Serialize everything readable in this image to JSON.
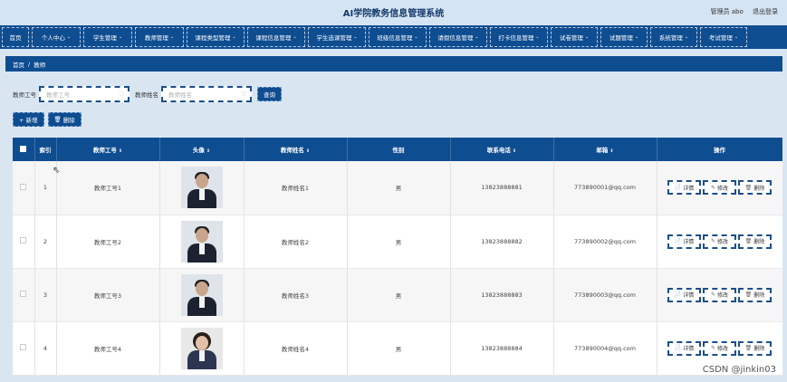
{
  "header": {
    "title": "AI学院教务信息管理系统",
    "user": "管理员 abo",
    "logout": "退出登录"
  },
  "nav": {
    "items": [
      {
        "label": "首页",
        "caret": false,
        "w": 30
      },
      {
        "label": "个人中心",
        "caret": true,
        "w": 54
      },
      {
        "label": "学生管理",
        "caret": true,
        "w": 54
      },
      {
        "label": "教师管理",
        "caret": true,
        "w": 54
      },
      {
        "label": "课程类型管理",
        "caret": true,
        "w": 64
      },
      {
        "label": "课程信息管理",
        "caret": true,
        "w": 64
      },
      {
        "label": "学生选课管理",
        "caret": true,
        "w": 64
      },
      {
        "label": "班级信息管理",
        "caret": true,
        "w": 64
      },
      {
        "label": "请假信息管理",
        "caret": true,
        "w": 64
      },
      {
        "label": "打卡信息管理",
        "caret": true,
        "w": 64
      },
      {
        "label": "试卷管理",
        "caret": true,
        "w": 52
      },
      {
        "label": "试题管理",
        "caret": true,
        "w": 52
      },
      {
        "label": "系统管理",
        "caret": true,
        "w": 52
      },
      {
        "label": "考试管理",
        "caret": true,
        "w": 52
      }
    ]
  },
  "breadcrumb": {
    "home": "首页",
    "sep": "/",
    "current": "教师"
  },
  "search": {
    "no_label": "教师工号",
    "no_placeholder": "教师工号",
    "name_label": "教师姓名",
    "name_placeholder": "教师姓名",
    "query_button": "查询"
  },
  "actions": {
    "add": "+ 新增",
    "delete": "删除"
  },
  "table": {
    "headers": {
      "index": "索引",
      "no": "教师工号",
      "avatar": "头像",
      "name": "教师姓名",
      "gender": "性别",
      "phone": "联系电话",
      "email": "邮箱",
      "ops": "操作"
    },
    "rows": [
      {
        "index": "1",
        "no": "教师工号1",
        "name": "教师姓名1",
        "gender": "男",
        "phone": "13823888881",
        "email": "773890001@qq.com",
        "avatar": "male"
      },
      {
        "index": "2",
        "no": "教师工号2",
        "name": "教师姓名2",
        "gender": "男",
        "phone": "13823888882",
        "email": "773890002@qq.com",
        "avatar": "male"
      },
      {
        "index": "3",
        "no": "教师工号3",
        "name": "教师姓名3",
        "gender": "男",
        "phone": "13823888883",
        "email": "773890003@qq.com",
        "avatar": "male"
      },
      {
        "index": "4",
        "no": "教师工号4",
        "name": "教师姓名4",
        "gender": "男",
        "phone": "13823888884",
        "email": "773890004@qq.com",
        "avatar": "female"
      }
    ],
    "row_ops": {
      "detail": "详情",
      "edit": "修改",
      "delete": "删除"
    }
  },
  "watermark": "CSDN @jinkin03"
}
